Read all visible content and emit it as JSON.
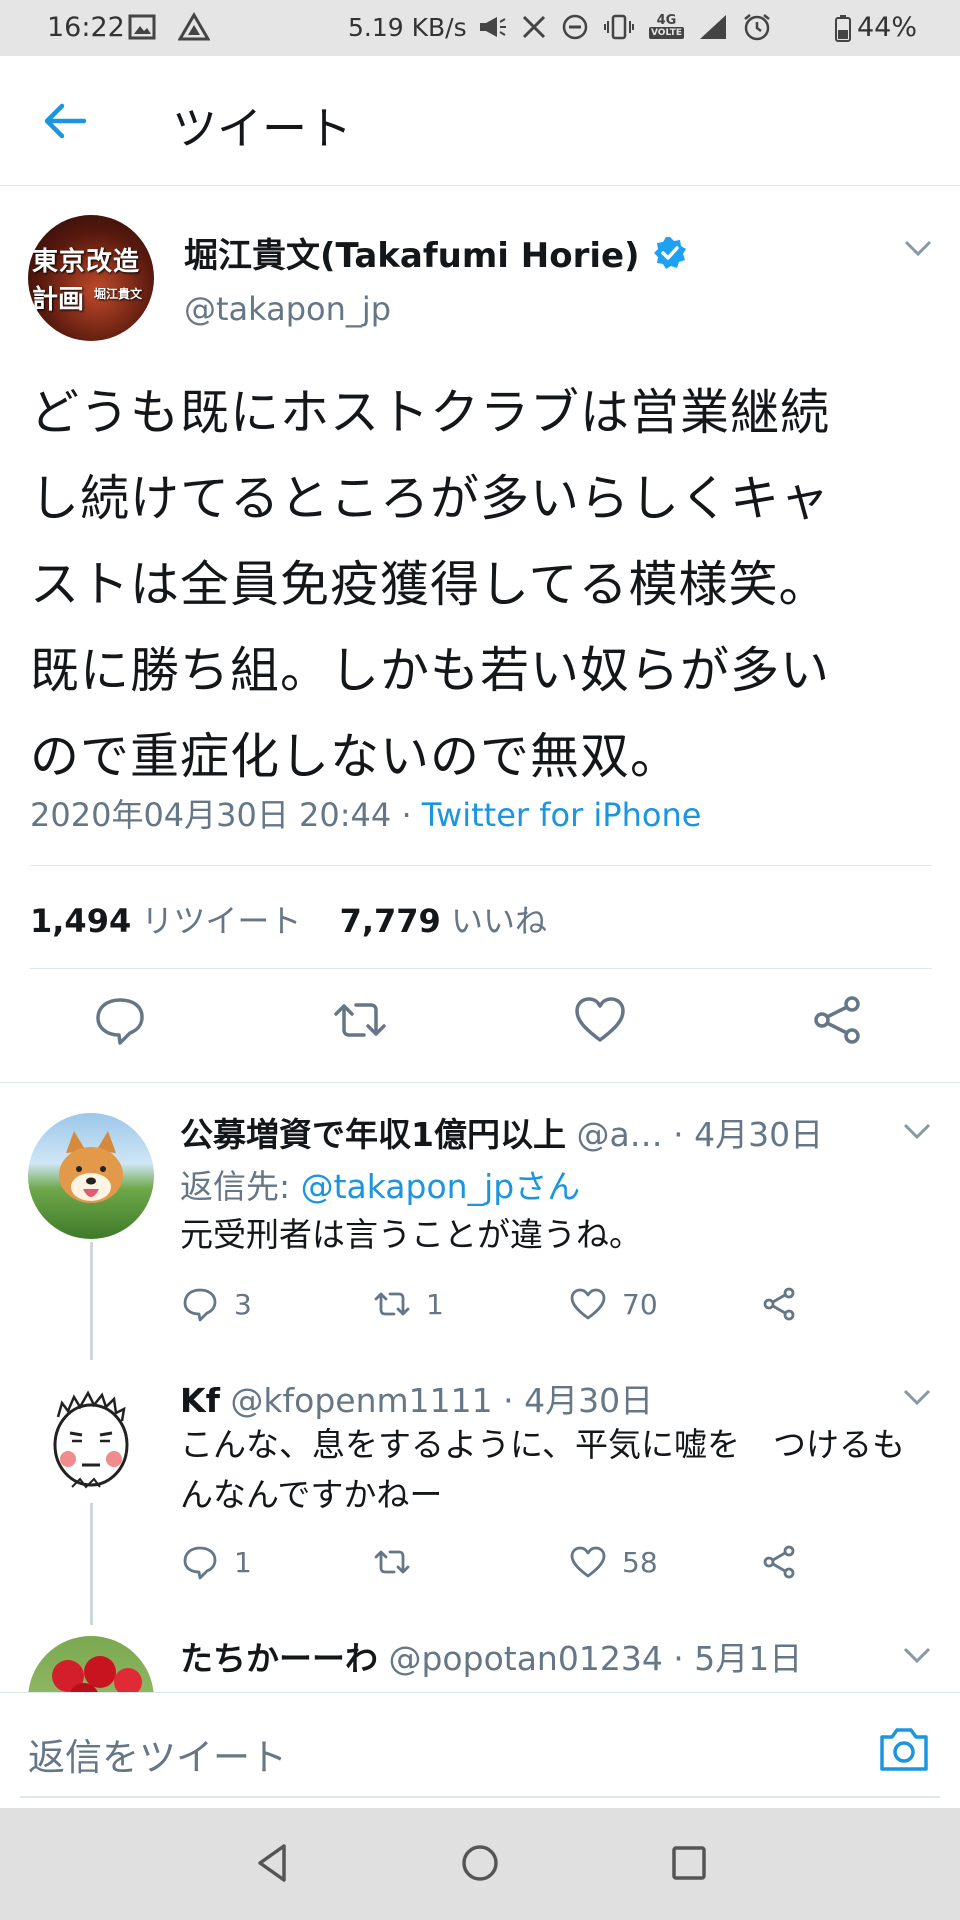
{
  "status_bar": {
    "time": "16:22",
    "net_speed": "5.19 KB/s",
    "network": "4G",
    "network_sub": "VOLTE",
    "battery": "44%"
  },
  "header": {
    "title": "ツイート"
  },
  "main_tweet": {
    "avatar_text_1": "東京改造",
    "avatar_text_2": "計画",
    "avatar_text_3": "堀江貴文",
    "author_name": "堀江貴文(Takafumi Horie)",
    "author_handle": "@takapon_jp",
    "text_lines": [
      "どうも既にホストクラブは営業継続",
      "し続けてるところが多いらしくキャ",
      "ストは全員免疫獲得してる模様笑。",
      "既に勝ち組。しかも若い奴らが多い",
      "ので重症化しないので無双。"
    ],
    "timestamp": "2020年04月30日 20:44 · ",
    "source": "Twitter for iPhone",
    "retweet_count": "1,494",
    "retweet_label": " リツイート",
    "like_count": "7,779",
    "like_label": " いいね"
  },
  "replies": [
    {
      "name": "公募増資で年収1億円以上",
      "handle_date": " @a… · 4月30日",
      "reply_to_prefix": "返信先: ",
      "reply_to_mention": "@takapon_jpさん",
      "text": "元受刑者は言うことが違うね。",
      "reply_count": "3",
      "retweet_count": "1",
      "like_count": "70"
    },
    {
      "name": "Kf",
      "handle_date": " @kfopenm1111 · 4月30日",
      "text": "こんな、息をするように、平気に嘘を　つけるもんなんですかねー",
      "reply_count": "1",
      "retweet_count": "",
      "like_count": "58"
    },
    {
      "name": "たちかーーわ",
      "handle_date": " @popotan01234 · 5月1日"
    }
  ],
  "compose": {
    "placeholder": "返信をツイート"
  },
  "colors": {
    "accent": "#1b95e0",
    "text": "#14171a",
    "secondary": "#657786",
    "border": "#e1e8ed"
  },
  "icons": {
    "back": "arrow-left-icon",
    "verified": "verified-badge-icon",
    "reply": "speech-bubble-icon",
    "retweet": "retweet-icon",
    "like": "heart-icon",
    "share": "share-icon",
    "camera": "camera-icon"
  }
}
